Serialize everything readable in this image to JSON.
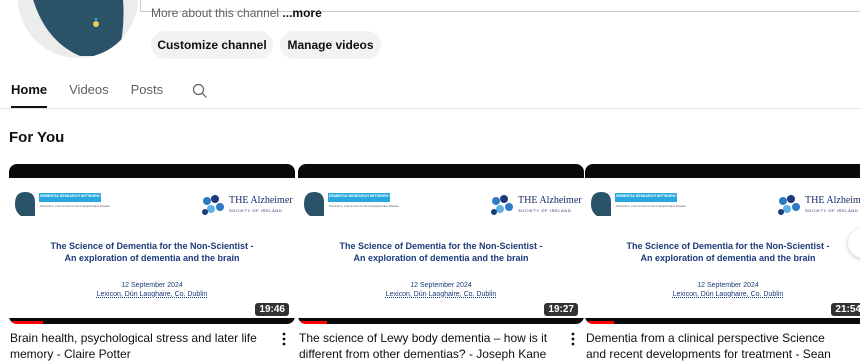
{
  "channel": {
    "about_text": "More about this channel ",
    "more_label": "...more"
  },
  "actions": {
    "customize_label": "Customize channel",
    "manage_label": "Manage videos"
  },
  "tabs": [
    {
      "label": "Home",
      "active": true
    },
    {
      "label": "Videos",
      "active": false
    },
    {
      "label": "Posts",
      "active": false
    }
  ],
  "section": {
    "title": "For You"
  },
  "thumbnail": {
    "org_left": "DEMENTIA RESEARCH NETWORK IRELAND",
    "org_left_sub": "Prevention, Cure & Care for Neurodegenerative Disease",
    "org_right": "THE Alzheimer",
    "org_right_sub": "SOCIETY OF IRELAND",
    "title_line1": "The Science of Dementia for the Non-Scientist -",
    "title_line2": "An exploration of dementia and the brain",
    "date": "12 September 2024",
    "venue": "Lexicon, Dún Laoghaire, Co. Dublin"
  },
  "videos": [
    {
      "title": "Brain health, psychological stress and later life memory - Claire Potter",
      "duration": "19:46",
      "progress": 0.12
    },
    {
      "title": "The science of Lewy body dementia – how is it different from other dementias? - Joseph Kane",
      "duration": "19:27",
      "progress": 0.1
    },
    {
      "title": "Dementia from a clinical perspective Science and recent developments for treatment - Sean Kennelly",
      "duration": "21:54",
      "progress": 0.1
    }
  ],
  "colors": {
    "accent": "#ff0000",
    "avatar": "#2b5368",
    "thumb_text": "#1d3a7a"
  }
}
